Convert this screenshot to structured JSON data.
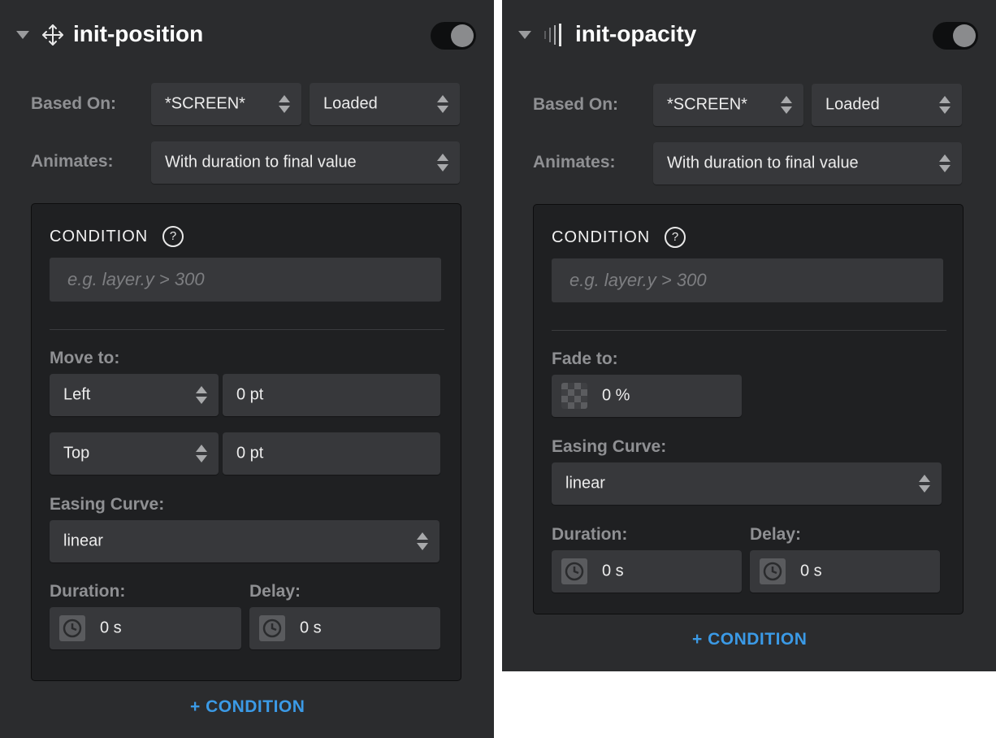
{
  "colors": {
    "accent": "#3b9ae6",
    "panel_bg": "#2b2c2e",
    "condition_bg": "#1f2022"
  },
  "panels": [
    {
      "title": "init-position",
      "icon": "move-arrows-icon",
      "enabled": true,
      "based_on_label": "Based On:",
      "based_on_value": "*SCREEN*",
      "trigger_value": "Loaded",
      "animates_label": "Animates:",
      "animates_value": "With duration to final value",
      "condition_title": "CONDITION",
      "condition_help": "?",
      "condition_placeholder": "e.g. layer.y > 300",
      "move_label": "Move to:",
      "move_rows": [
        {
          "prop": "Left",
          "value": "0 pt"
        },
        {
          "prop": "Top",
          "value": "0 pt"
        }
      ],
      "easing_label": "Easing Curve:",
      "easing_value": "linear",
      "duration_label": "Duration:",
      "duration_value": "0 s",
      "delay_label": "Delay:",
      "delay_value": "0 s",
      "add_condition": "+ CONDITION"
    },
    {
      "title": "init-opacity",
      "icon": "opacity-bars-icon",
      "enabled": true,
      "based_on_label": "Based On:",
      "based_on_value": "*SCREEN*",
      "trigger_value": "Loaded",
      "animates_label": "Animates:",
      "animates_value": "With duration to final value",
      "condition_title": "CONDITION",
      "condition_help": "?",
      "condition_placeholder": "e.g. layer.y > 300",
      "fade_label": "Fade to:",
      "fade_value": "0 %",
      "easing_label": "Easing Curve:",
      "easing_value": "linear",
      "duration_label": "Duration:",
      "duration_value": "0 s",
      "delay_label": "Delay:",
      "delay_value": "0 s",
      "add_condition": "+ CONDITION"
    }
  ]
}
